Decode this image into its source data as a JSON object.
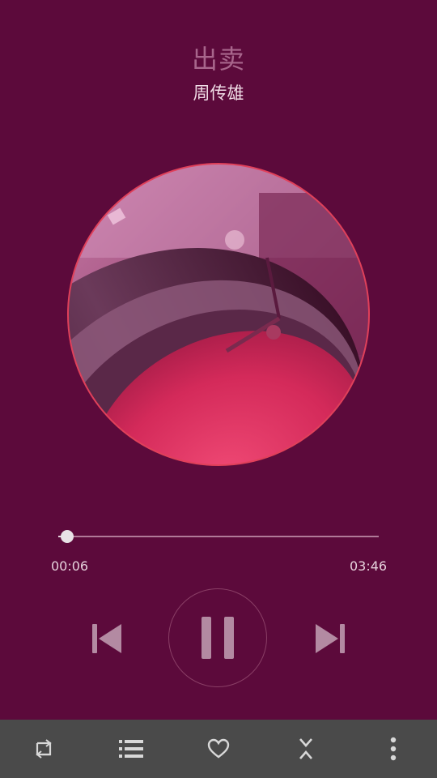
{
  "song": {
    "title": "出卖",
    "artist": "周传雄"
  },
  "playback": {
    "current_time": "00:06",
    "total_time": "03:46",
    "progress": 0.027,
    "state": "playing"
  },
  "colors": {
    "background": "#5c0a3b",
    "bottom_bar": "#4a4a4a",
    "accent_ring": "#e0405a",
    "icon": "#b38aa2"
  },
  "controls": {
    "previous_icon": "skip-previous-icon",
    "pause_icon": "pause-icon",
    "next_icon": "skip-next-icon"
  },
  "bottom_bar": {
    "items": [
      {
        "icon": "repeat-icon"
      },
      {
        "icon": "playlist-icon"
      },
      {
        "icon": "heart-icon"
      },
      {
        "icon": "collapse-icon"
      },
      {
        "icon": "more-vert-icon"
      }
    ]
  }
}
